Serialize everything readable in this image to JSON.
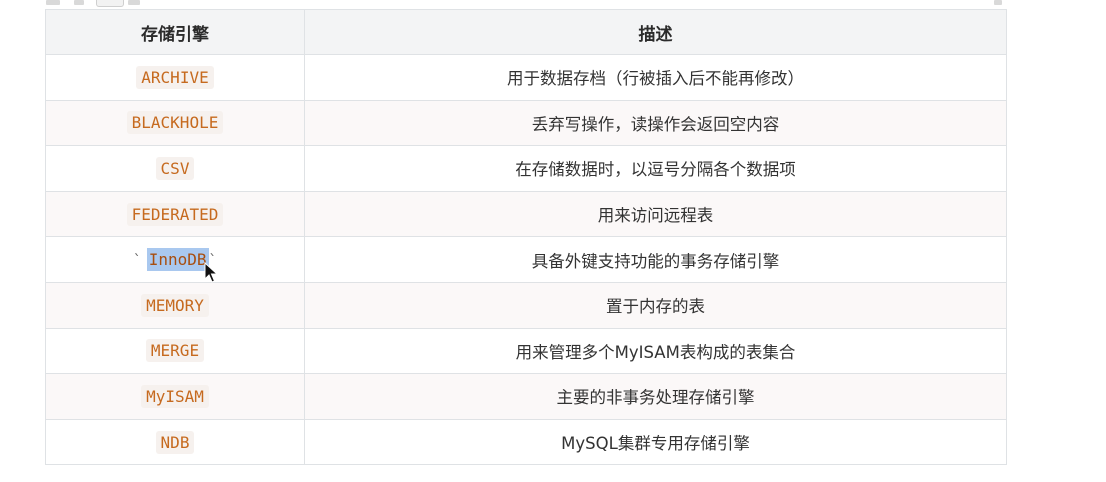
{
  "table": {
    "headers": [
      "存储引擎",
      "描述"
    ],
    "rows": [
      {
        "engine": "ARCHIVE",
        "desc": "用于数据存档（行被插入后不能再修改）"
      },
      {
        "engine": "BLACKHOLE",
        "desc": "丢弃写操作，读操作会返回空内容"
      },
      {
        "engine": "CSV",
        "desc": "在存储数据时，以逗号分隔各个数据项"
      },
      {
        "engine": "FEDERATED",
        "desc": "用来访问远程表"
      },
      {
        "engine": "InnoDB",
        "desc": "具备外键支持功能的事务存储引擎",
        "raw_tick": "`"
      },
      {
        "engine": "MEMORY",
        "desc": "置于内存的表"
      },
      {
        "engine": "MERGE",
        "desc": "用来管理多个MyISAM表构成的表集合"
      },
      {
        "engine": "MyISAM",
        "desc": "主要的非事务处理存储引擎"
      },
      {
        "engine": "NDB",
        "desc": "MySQL集群专用存储引擎"
      }
    ]
  },
  "colors": {
    "code_text": "#c66a1f",
    "selection": "#a9c8ef",
    "header_bg": "#f3f4f5",
    "border": "#dfe2e5"
  }
}
